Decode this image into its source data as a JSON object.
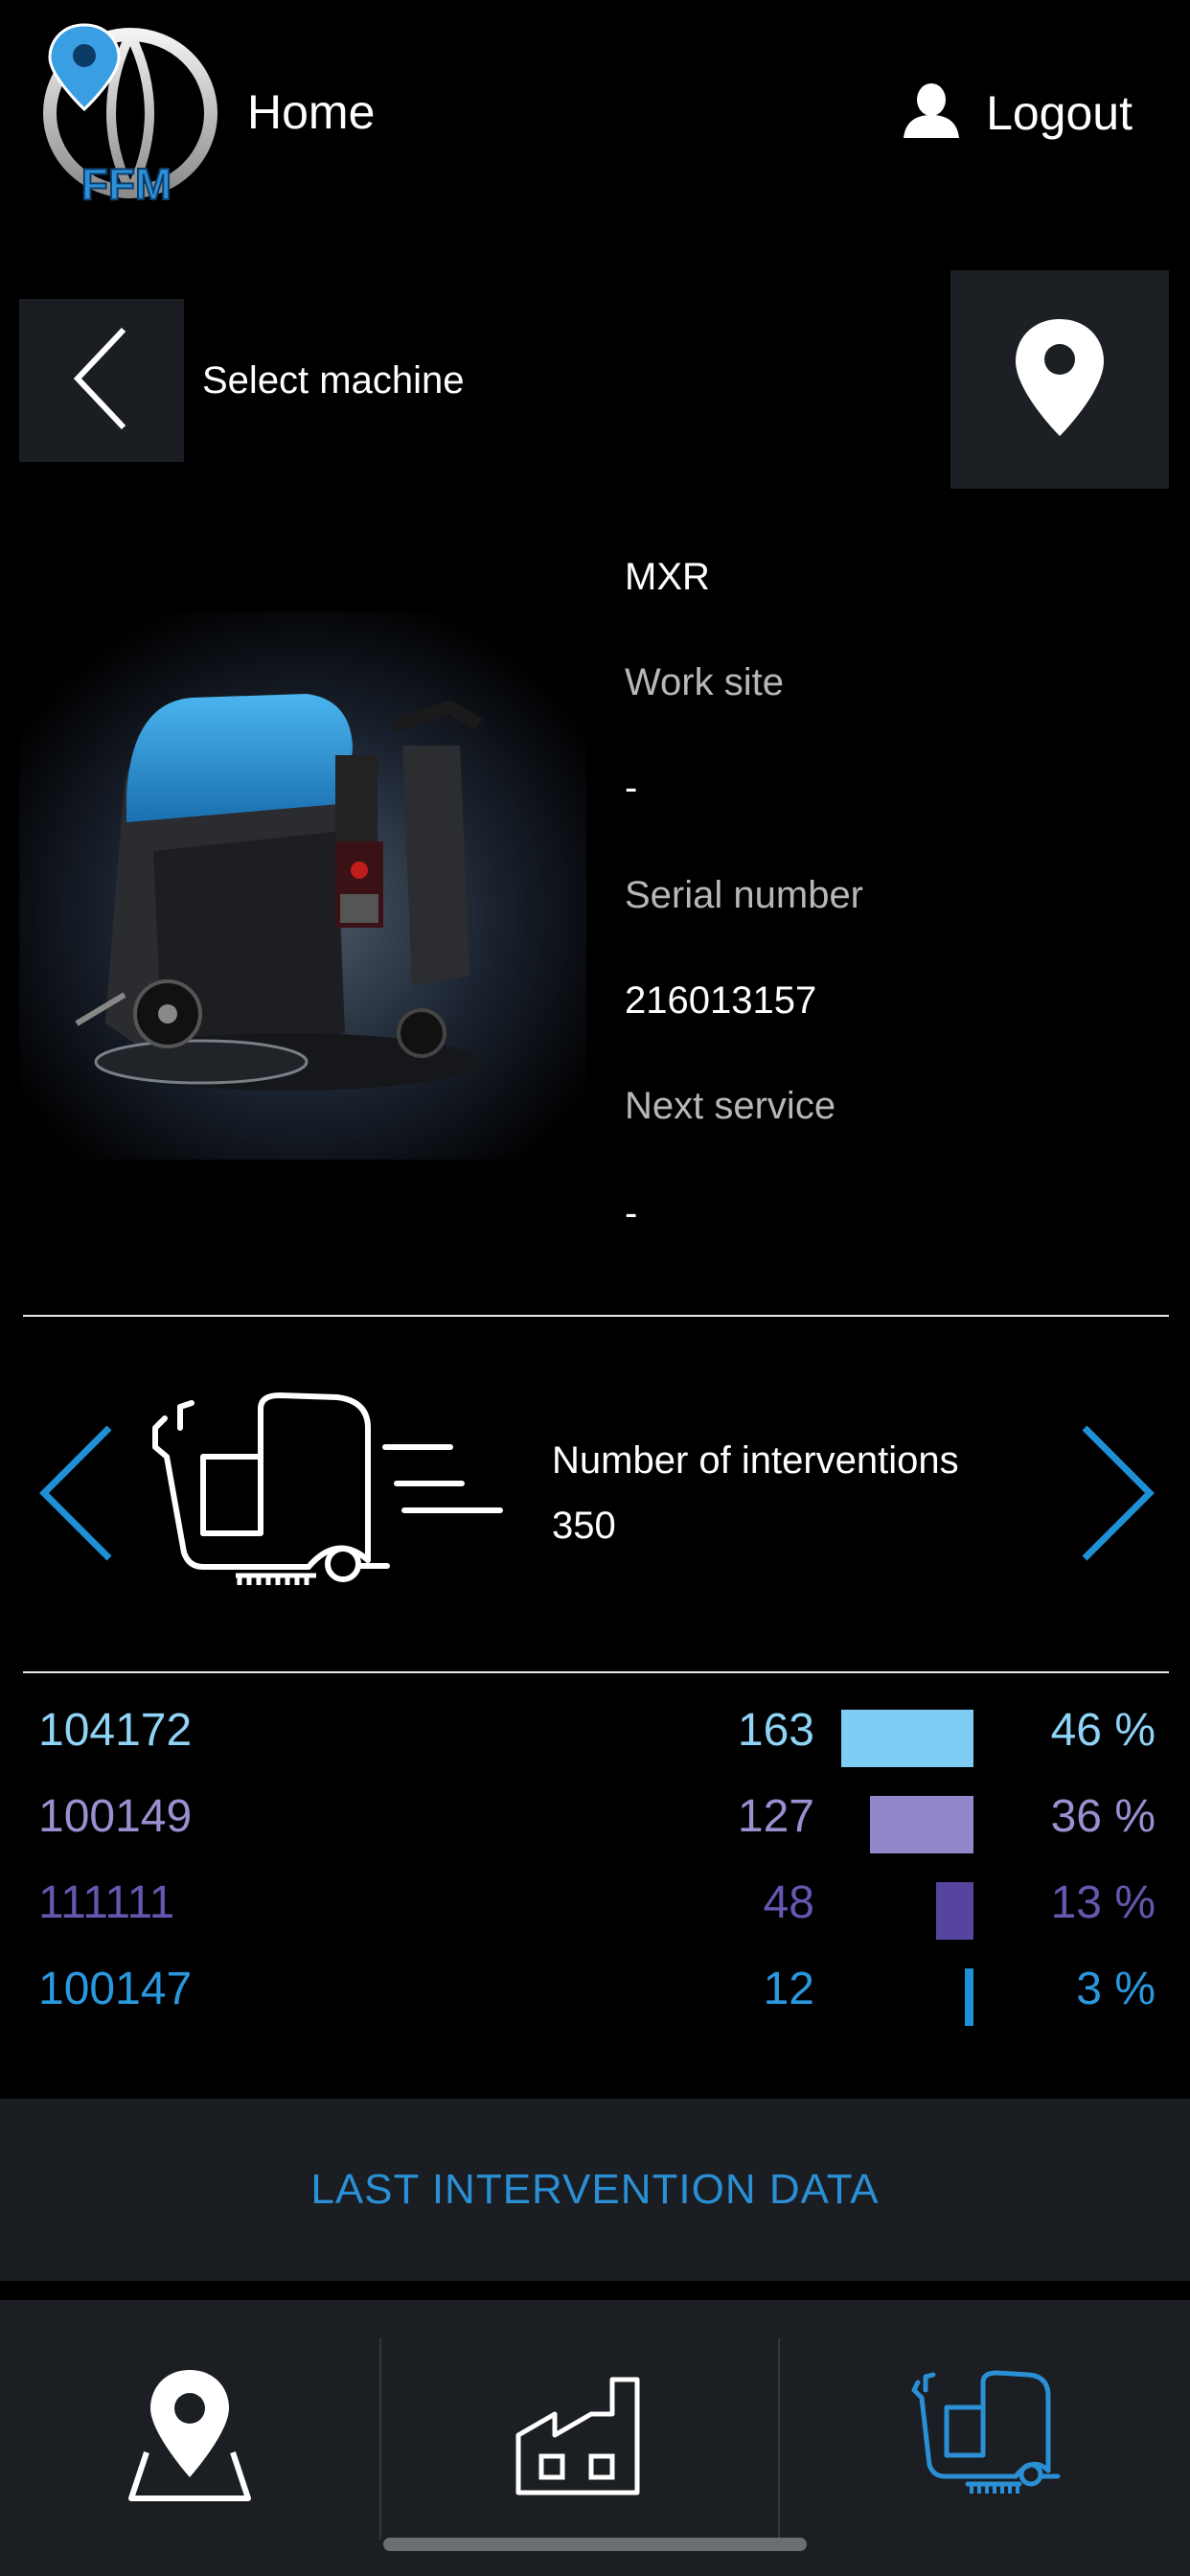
{
  "header": {
    "logo_text": "FFM",
    "home_label": "Home",
    "logout_label": "Logout"
  },
  "nav": {
    "select_machine_label": "Select machine"
  },
  "machine": {
    "model": "MXR",
    "work_site_label": "Work site",
    "work_site_value": "-",
    "serial_label": "Serial number",
    "serial_value": "216013157",
    "next_service_label": "Next service",
    "next_service_value": "-"
  },
  "interventions": {
    "title": "Number of interventions",
    "count": "350"
  },
  "stats": [
    {
      "code": "104172",
      "count": "163",
      "percent": "46 %",
      "share": 0.46,
      "color": "#7fcdf5",
      "text_color": "#8fd3f7"
    },
    {
      "code": "100149",
      "count": "127",
      "percent": "36 %",
      "share": 0.36,
      "color": "#9287c9",
      "text_color": "#9a8fd0"
    },
    {
      "code": "111111",
      "count": "48",
      "percent": "13 %",
      "share": 0.13,
      "color": "#56449e",
      "text_color": "#6656b0"
    },
    {
      "code": "100147",
      "count": "12",
      "percent": "3 %",
      "share": 0.03,
      "color": "#1f8fd6",
      "text_color": "#2a98de"
    }
  ],
  "last_intervention_label": "LAST INTERVENTION DATA",
  "tabs": [
    {
      "name": "map",
      "icon": "map-pin-icon",
      "active": false
    },
    {
      "name": "factory",
      "icon": "factory-icon",
      "active": false
    },
    {
      "name": "machine",
      "icon": "scrubber-machine-icon",
      "active": true
    }
  ],
  "colors": {
    "accent": "#2a8fd4",
    "panel": "#1a1d21",
    "background": "#000000"
  }
}
